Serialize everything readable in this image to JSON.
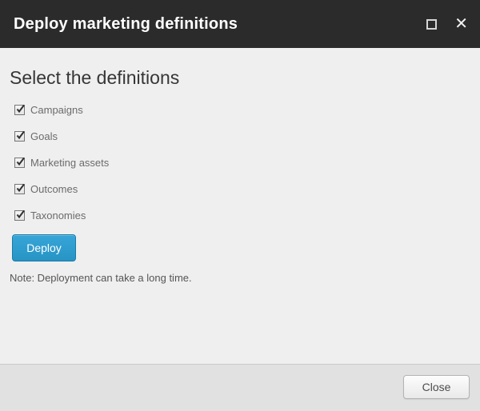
{
  "dialog": {
    "title": "Deploy marketing definitions",
    "heading": "Select the definitions",
    "checkboxes": [
      {
        "label": "Campaigns",
        "checked": true
      },
      {
        "label": "Goals",
        "checked": true
      },
      {
        "label": "Marketing assets",
        "checked": true
      },
      {
        "label": "Outcomes",
        "checked": true
      },
      {
        "label": "Taxonomies",
        "checked": true
      }
    ],
    "deploy_label": "Deploy",
    "note": "Note: Deployment can take a long time.",
    "close_label": "Close"
  },
  "icons": {
    "maximize": "maximize-square",
    "close_glyph": "✕"
  },
  "colors": {
    "header_bg": "#2b2b2b",
    "content_bg": "#efefef",
    "footer_bg": "#e1e1e1",
    "accent_blue": "#2b9ed3",
    "heading_text": "#363636",
    "label_text": "#6b6b6b"
  }
}
